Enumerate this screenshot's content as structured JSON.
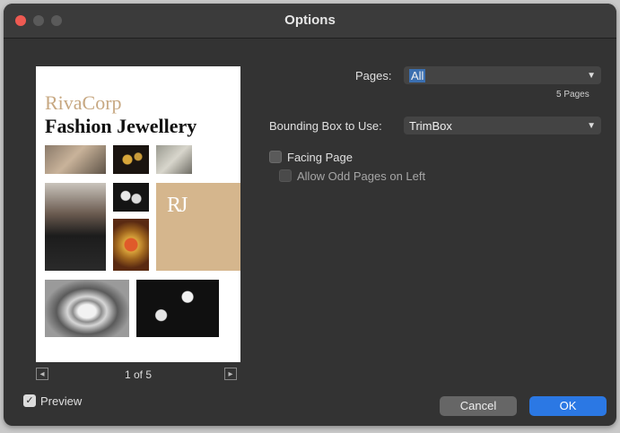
{
  "window": {
    "title": "Options"
  },
  "preview": {
    "brand_line1": "RivaCorp",
    "brand_line2": "Fashion Jewellery",
    "logo_text": "RJ",
    "page_indicator": "1 of 5",
    "prev_icon": "arrow-left-icon",
    "next_icon": "arrow-right-icon",
    "checkbox_label": "Preview",
    "checkbox_checked": true
  },
  "options": {
    "pages_label": "Pages:",
    "pages_value": "All",
    "pages_count": "5 Pages",
    "bbox_label": "Bounding Box to Use:",
    "bbox_value": "TrimBox",
    "facing_label": "Facing Page",
    "facing_checked": false,
    "allow_odd_label": "Allow Odd Pages on Left",
    "allow_odd_checked": false
  },
  "buttons": {
    "cancel": "Cancel",
    "ok": "OK"
  },
  "colors": {
    "accent": "#2b78e4",
    "close_light": "#ee5a52",
    "brand_gold": "#d5b68d"
  }
}
